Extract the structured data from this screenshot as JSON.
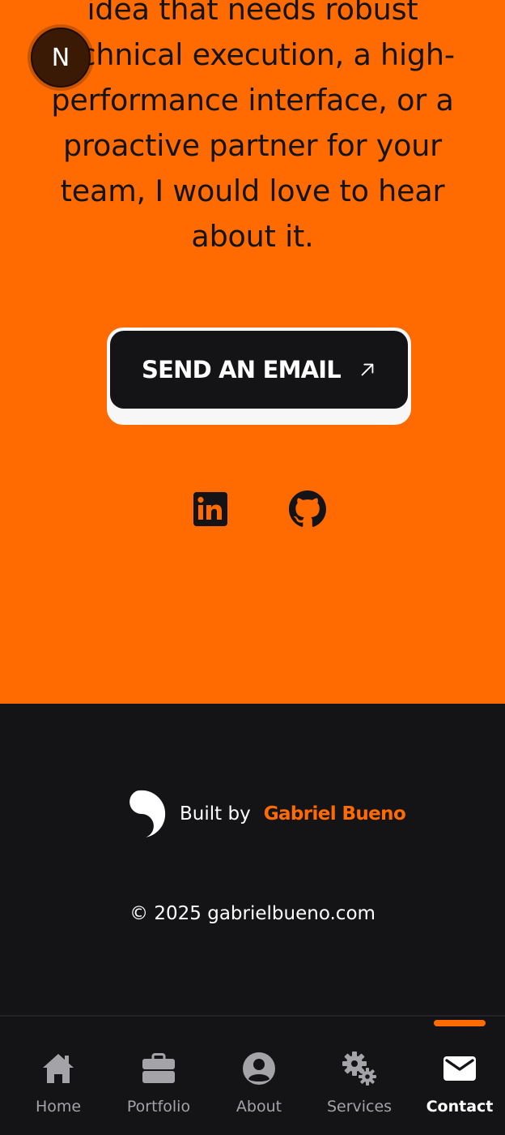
{
  "contact": {
    "intro_text": "idea that needs robust technical execution, a high-performance interface, or a proactive partner for your team, I would love to hear about it.",
    "email_button_label": "SEND AN EMAIL"
  },
  "badge": {
    "letter": "N"
  },
  "social": [
    {
      "icon": "linkedin-icon"
    },
    {
      "icon": "github-icon"
    }
  ],
  "footer": {
    "built_by": "Built by",
    "author": "Gabriel Bueno",
    "copyright": "© 2025 gabrielbueno.com"
  },
  "bottom_nav": {
    "items": [
      {
        "label": "Home",
        "icon": "home-icon"
      },
      {
        "label": "Portfolio",
        "icon": "briefcase-icon"
      },
      {
        "label": "About",
        "icon": "user-circle-icon"
      },
      {
        "label": "Services",
        "icon": "gears-icon"
      },
      {
        "label": "Contact",
        "icon": "envelope-icon"
      }
    ],
    "active": "Contact"
  },
  "colors": {
    "accent": "#ff6b00",
    "dark": "#141417",
    "nav_inactive": "#a3a3a8"
  }
}
